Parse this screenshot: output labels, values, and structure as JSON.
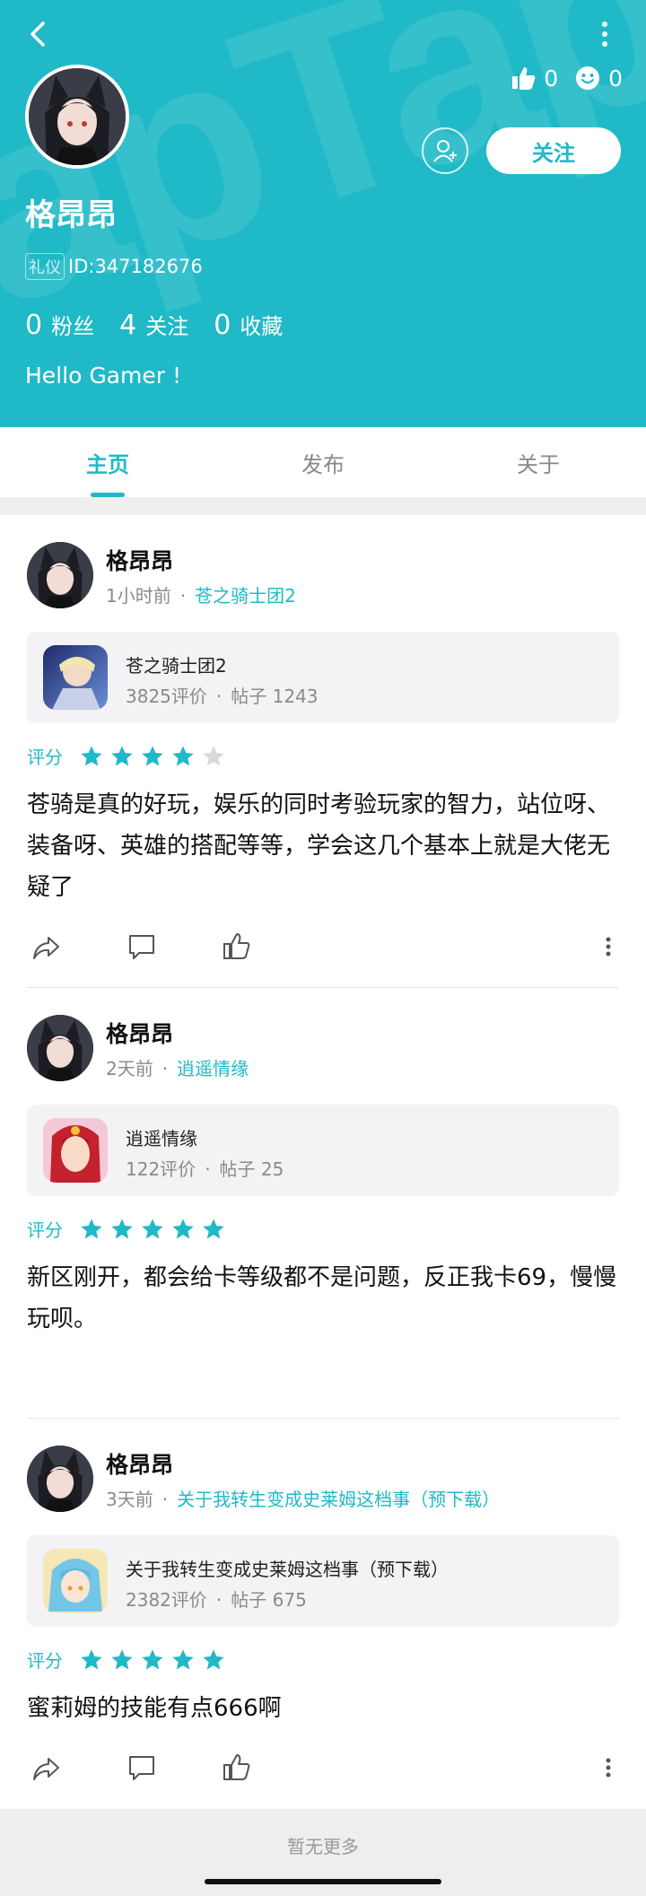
{
  "header": {
    "username": "格昂昂",
    "id_tag": "礼仪",
    "id_text": "ID:347182676",
    "likes_count": "0",
    "smile_count": "0",
    "follow_label": "关注",
    "bio": "Hello Gamer !",
    "stats": [
      {
        "num": "0",
        "label": "粉丝"
      },
      {
        "num": "4",
        "label": "关注"
      },
      {
        "num": "0",
        "label": "收藏"
      }
    ]
  },
  "tabs": [
    {
      "label": "主页",
      "active": true
    },
    {
      "label": "发布",
      "active": false
    },
    {
      "label": "关于",
      "active": false
    }
  ],
  "posts": [
    {
      "author": "格昂昂",
      "time": "1小时前",
      "sep": "·",
      "game": "苍之骑士团2",
      "card": {
        "title": "苍之骑士团2",
        "reviews": "3825评价",
        "posts": "帖子 1243"
      },
      "rating_label": "评分",
      "rating": 4,
      "text": "苍骑是真的好玩，娱乐的同时考验玩家的智力，站位呀、装备呀、英雄的搭配等等，学会这几个基本上就是大佬无疑了"
    },
    {
      "author": "格昂昂",
      "time": "2天前",
      "sep": "·",
      "game": "逍遥情缘",
      "card": {
        "title": "逍遥情缘",
        "reviews": "122评价",
        "posts": "帖子 25"
      },
      "rating_label": "评分",
      "rating": 5,
      "text": "新区刚开，都会给卡等级都不是问题，反正我卡69，慢慢玩呗。"
    },
    {
      "author": "格昂昂",
      "time": "3天前",
      "sep": "·",
      "game": "关于我转生变成史莱姆这档事（预下载）",
      "card": {
        "title": "关于我转生变成史莱姆这档事（预下载）",
        "reviews": "2382评价",
        "posts": "帖子 675"
      },
      "rating_label": "评分",
      "rating": 5,
      "text": "蜜莉姆的技能有点666啊"
    }
  ],
  "footer": {
    "text": "暂无更多"
  },
  "colors": {
    "accent": "#20b9c7",
    "star_empty": "#d9d9d9"
  }
}
